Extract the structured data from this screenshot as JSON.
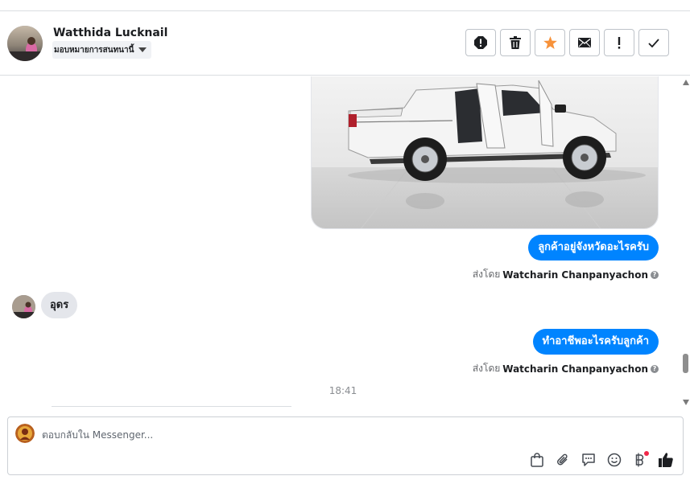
{
  "contact": {
    "name": "Watthida Lucknail",
    "assign_label": "มอบหมายการสนทนานี้"
  },
  "actions": [
    {
      "name": "report-icon",
      "color": "#1c1e21"
    },
    {
      "name": "trash-icon",
      "color": "#1c1e21"
    },
    {
      "name": "star-icon",
      "color": "#f7923a"
    },
    {
      "name": "mail-icon",
      "color": "#1c1e21"
    },
    {
      "name": "exclamation-icon",
      "color": "#1c1e21"
    },
    {
      "name": "check-icon",
      "color": "#1c1e21"
    }
  ],
  "messages": {
    "out1": "ลูกค้าอยู่จังหวัดอะไรครับ",
    "in1": "อุดร",
    "out2": "ทำอาชีพอะไรครับลูกค้า",
    "sent_by_prefix": "ส่งโดย",
    "sent_by_name": "Watcharin Chanpanyachon",
    "timestamp": "18:41"
  },
  "reply": {
    "placeholder": "ตอบกลับใน Messenger..."
  },
  "toolbar_icons": [
    "shopping-bag-icon",
    "paperclip-icon",
    "saved-replies-icon",
    "emoji-icon",
    "baht-icon",
    "like-icon"
  ],
  "colors": {
    "accent": "#0084ff",
    "incoming_bubble": "#e4e6eb",
    "notification_dot": "#f02849"
  }
}
